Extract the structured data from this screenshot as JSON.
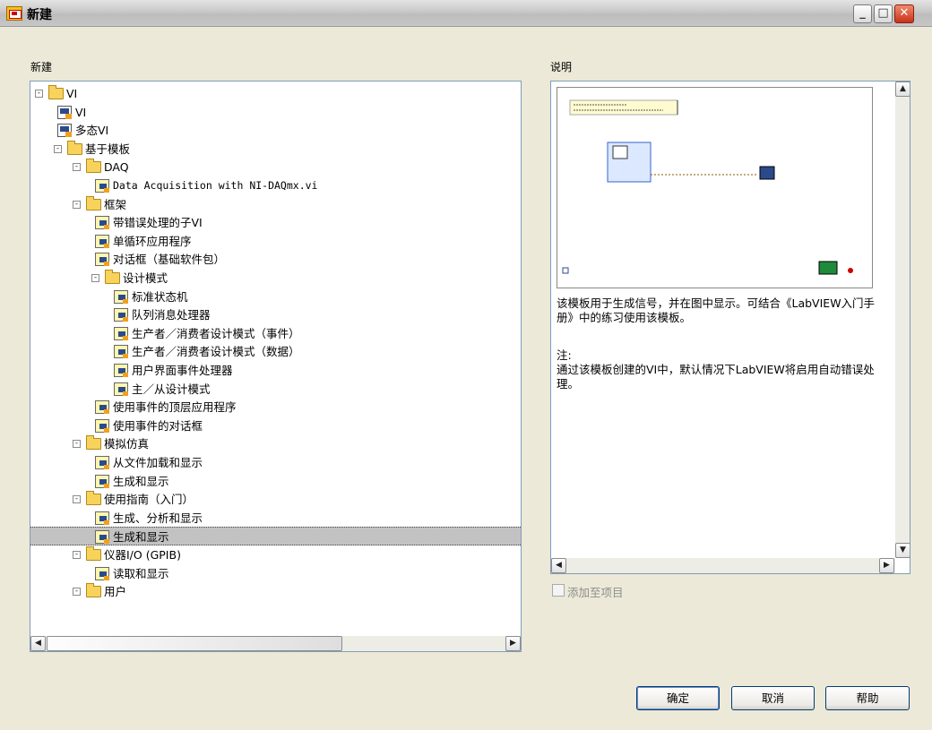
{
  "window": {
    "title": "新建"
  },
  "left_panel": {
    "label": "新建",
    "tree": [
      {
        "label": "VI",
        "kind": "folder",
        "depth": 0,
        "expander": "-"
      },
      {
        "label": "VI",
        "kind": "vi",
        "depth": 1
      },
      {
        "label": "多态VI",
        "kind": "vi",
        "depth": 1
      },
      {
        "label": "基于模板",
        "kind": "folder",
        "depth": 1,
        "expander": "-"
      },
      {
        "label": "DAQ",
        "kind": "folder",
        "depth": 2,
        "expander": "-"
      },
      {
        "label": "Data Acquisition with NI-DAQmx.vi",
        "kind": "template",
        "depth": 3,
        "mono": true
      },
      {
        "label": "框架",
        "kind": "folder",
        "depth": 2,
        "expander": "-"
      },
      {
        "label": "带错误处理的子VI",
        "kind": "template",
        "depth": 3
      },
      {
        "label": "单循环应用程序",
        "kind": "template",
        "depth": 3
      },
      {
        "label": "对话框（基础软件包）",
        "kind": "template",
        "depth": 3
      },
      {
        "label": "设计模式",
        "kind": "folder",
        "depth": 3,
        "expander": "-"
      },
      {
        "label": "标准状态机",
        "kind": "template",
        "depth": 4
      },
      {
        "label": "队列消息处理器",
        "kind": "template",
        "depth": 4
      },
      {
        "label": "生产者／消费者设计模式（事件）",
        "kind": "template",
        "depth": 4
      },
      {
        "label": "生产者／消费者设计模式（数据）",
        "kind": "template",
        "depth": 4
      },
      {
        "label": "用户界面事件处理器",
        "kind": "template",
        "depth": 4
      },
      {
        "label": "主／从设计模式",
        "kind": "template",
        "depth": 4
      },
      {
        "label": "使用事件的顶层应用程序",
        "kind": "template",
        "depth": 3
      },
      {
        "label": "使用事件的对话框",
        "kind": "template",
        "depth": 3
      },
      {
        "label": "模拟仿真",
        "kind": "folder",
        "depth": 2,
        "expander": "-"
      },
      {
        "label": "从文件加载和显示",
        "kind": "template",
        "depth": 3
      },
      {
        "label": "生成和显示",
        "kind": "template",
        "depth": 3
      },
      {
        "label": "使用指南（入门）",
        "kind": "folder",
        "depth": 2,
        "expander": "-"
      },
      {
        "label": "生成、分析和显示",
        "kind": "template",
        "depth": 3
      },
      {
        "label": "生成和显示",
        "kind": "template",
        "depth": 3,
        "selected": true
      },
      {
        "label": "仪器I/O (GPIB)",
        "kind": "folder",
        "depth": 2,
        "expander": "-"
      },
      {
        "label": "读取和显示",
        "kind": "template",
        "depth": 3
      },
      {
        "label": "用户",
        "kind": "folder",
        "depth": 2,
        "expander": "-"
      }
    ]
  },
  "right_panel": {
    "label": "说明",
    "description_1": "该模板用于生成信号，并在图中显示。可结合《LabVIEW入门手册》中的练习使用该模板。",
    "note_label": "注:",
    "note_text": "通过该模板创建的VI中，默认情况下LabVIEW将启用自动错误处理。",
    "add_to_project_label": "添加至项目",
    "add_to_project_checked": false,
    "add_to_project_enabled": false
  },
  "buttons": {
    "ok": "确定",
    "cancel": "取消",
    "help": "帮助"
  },
  "icons": {
    "app": "labview-new-icon",
    "folder": "folder-icon",
    "vi": "vi-icon",
    "template": "vi-template-icon",
    "minimize": "minimize-icon",
    "maximize": "maximize-icon",
    "close": "close-icon"
  },
  "colors": {
    "selection": "#c2c2c2",
    "panel_border": "#7f9db9",
    "dialog_bg": "#ece9d8",
    "close_button": "#c9321a"
  }
}
